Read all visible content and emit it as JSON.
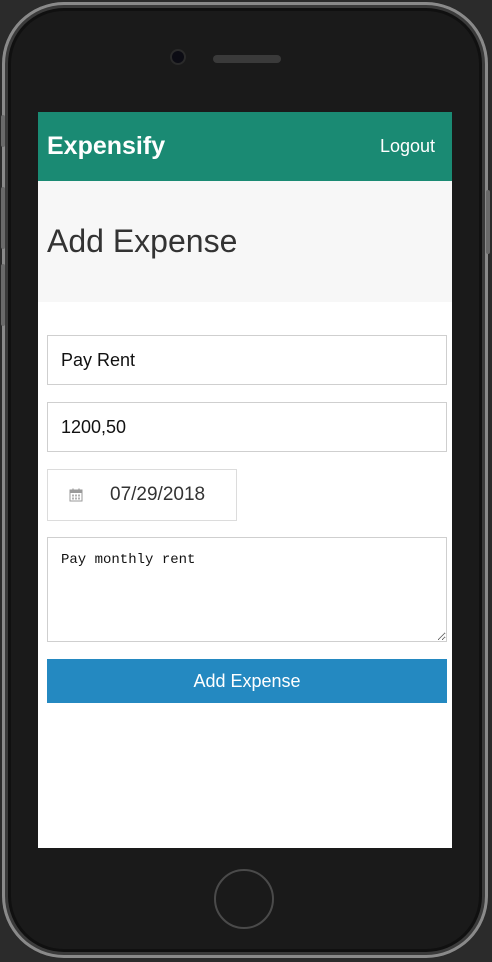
{
  "app": {
    "brand": "Expensify",
    "logout_label": "Logout"
  },
  "page": {
    "title": "Add Expense"
  },
  "form": {
    "description_value": "Pay Rent",
    "amount_value": "1200,50",
    "date_value": "07/29/2018",
    "note_value": "Pay monthly rent",
    "submit_label": "Add Expense"
  },
  "colors": {
    "header": "#1a8a73",
    "button": "#2489c1",
    "page_header_bg": "#f7f7f7"
  },
  "icons": {
    "date": "calendar-icon"
  }
}
